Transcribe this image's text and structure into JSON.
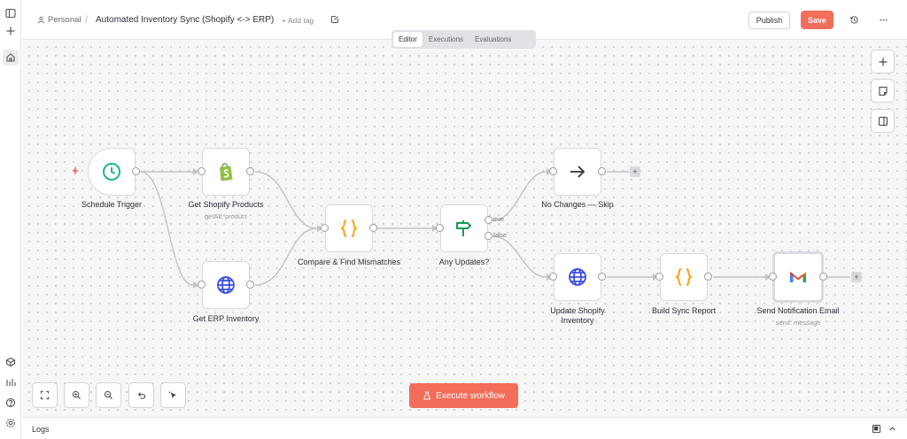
{
  "header": {
    "workspace": "Personal",
    "title": "Automated Inventory Sync (Shopify <-> ERP)",
    "add_tag": "+ Add tag",
    "publish_label": "Publish",
    "save_label": "Save"
  },
  "tabs": [
    {
      "label": "Editor",
      "active": true
    },
    {
      "label": "Executions",
      "active": false
    },
    {
      "label": "Evaluations",
      "active": false
    }
  ],
  "nodes": {
    "schedule": {
      "label": "Schedule Trigger"
    },
    "shopify": {
      "label": "Get Shopify Products",
      "sub": "getAll: product"
    },
    "erp": {
      "label": "Get ERP Inventory"
    },
    "compare": {
      "label": "Compare & Find Mismatches"
    },
    "if": {
      "label": "Any Updates?",
      "true_label": "true",
      "false_label": "false"
    },
    "skip": {
      "label": "No Changes — Skip"
    },
    "update": {
      "label": "Update Shopify Inventory"
    },
    "report": {
      "label": "Build Sync Report"
    },
    "email": {
      "label": "Send Notification Email",
      "sub": "send: message"
    }
  },
  "execute_label": "Execute workflow",
  "logs_label": "Logs",
  "colors": {
    "accent": "#f26d5a",
    "trigger_green": "#1fb58f",
    "code_orange": "#f6a31b",
    "http_blue": "#3c4ee0",
    "if_green": "#139b54",
    "shopify_green": "#95bf47"
  }
}
